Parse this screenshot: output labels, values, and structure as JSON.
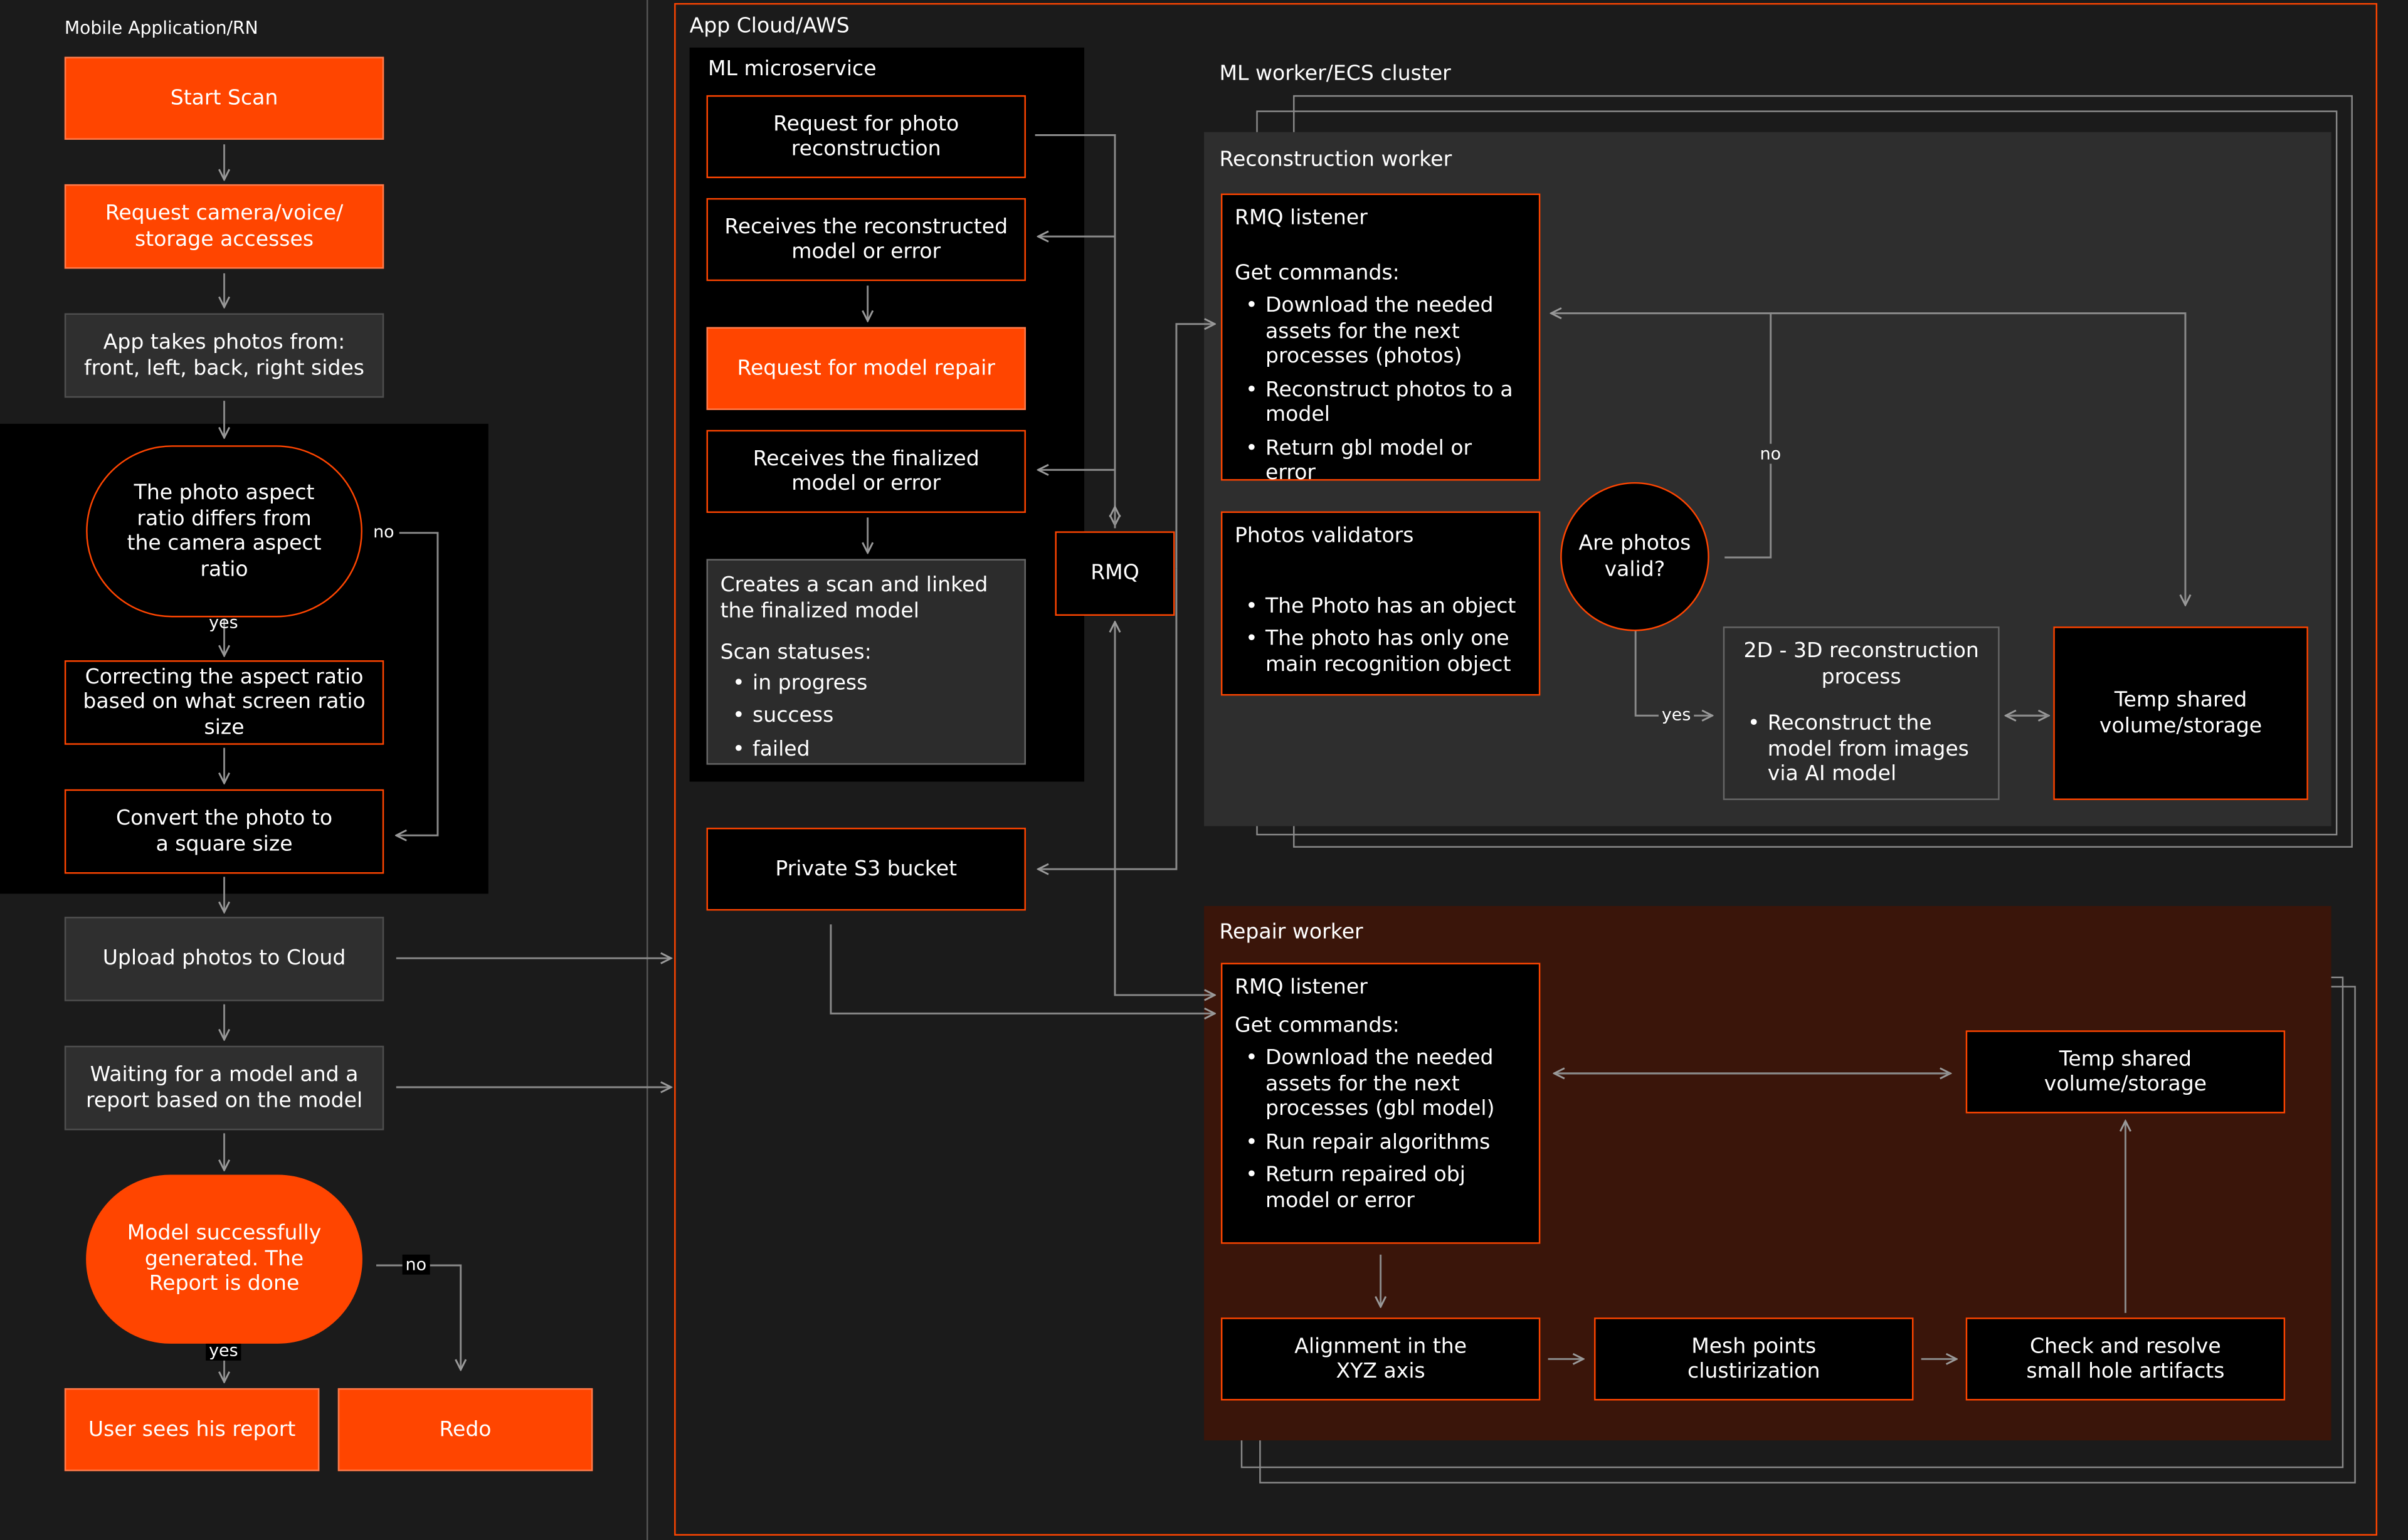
{
  "colors": {
    "background": "#1b1b1b",
    "accent": "#ff4500",
    "panel": "#000000",
    "worker": "#2e2e2e",
    "repair": "#3a150a"
  },
  "sections": {
    "mobile": "Mobile Application/RN",
    "cloud": "App Cloud/AWS",
    "ml_microservice": "ML microservice",
    "ml_worker": "ML worker/ECS cluster",
    "reconstruction_worker": "Reconstruction worker",
    "repair_worker": "Repair worker"
  },
  "mobile": {
    "start_scan": "Start Scan",
    "request_access": "Request camera/voice/ storage accesses",
    "take_photos": "App takes photos from: front, left, back, right sides",
    "aspect_check": "The photo aspect ratio differs from the camera aspect ratio",
    "correct_ratio": "Correcting the aspect ratio based on what screen ratio size",
    "convert_square": "Convert the photo to a square size",
    "upload": "Upload photos to Cloud",
    "waiting": "Waiting for a model and a report based on the model",
    "model_generated": "Model successfully generated. The Report is done",
    "user_report": "User sees his report",
    "redo": "Redo"
  },
  "ml": {
    "request_reconstruction": "Request for photo reconstruction",
    "receives_reconstructed": "Receives the reconstructed model or error",
    "request_repair": "Request for model repair",
    "receives_finalized": "Receives the finalized model or error",
    "creates_scan": "Creates a scan and linked the finalized model",
    "scan_statuses": "Scan statuses:",
    "statuses": [
      "in progress",
      "success",
      "failed"
    ],
    "rmq": "RMQ",
    "s3": "Private S3 bucket"
  },
  "reconstruction": {
    "rmq_title": "RMQ listener",
    "get_commands": "Get commands:",
    "commands": [
      "Download the needed assets for the next processes (photos)",
      "Reconstruct photos to a model",
      "Return gbl model or error"
    ],
    "validators_title": "Photos validators",
    "validators": [
      "The Photo has an object",
      "The photo has only one main recognition object"
    ],
    "are_valid": "Are photos valid?",
    "process_title": "2D - 3D reconstruction process",
    "process_items": [
      "Reconstruct the model from images via AI model"
    ],
    "temp_storage": "Temp shared volume/storage"
  },
  "repair": {
    "rmq_title": "RMQ listener",
    "get_commands": "Get commands:",
    "commands": [
      "Download the needed assets for the next processes (gbl model)",
      "Run repair algorithms",
      "Return repaired obj model or error"
    ],
    "temp_storage": "Temp shared volume/storage",
    "alignment": "Alignment in the XYZ axis",
    "mesh": "Mesh points clustirization",
    "holes": "Check and resolve small hole artifacts"
  },
  "edge_labels": {
    "yes": "yes",
    "no": "no"
  }
}
